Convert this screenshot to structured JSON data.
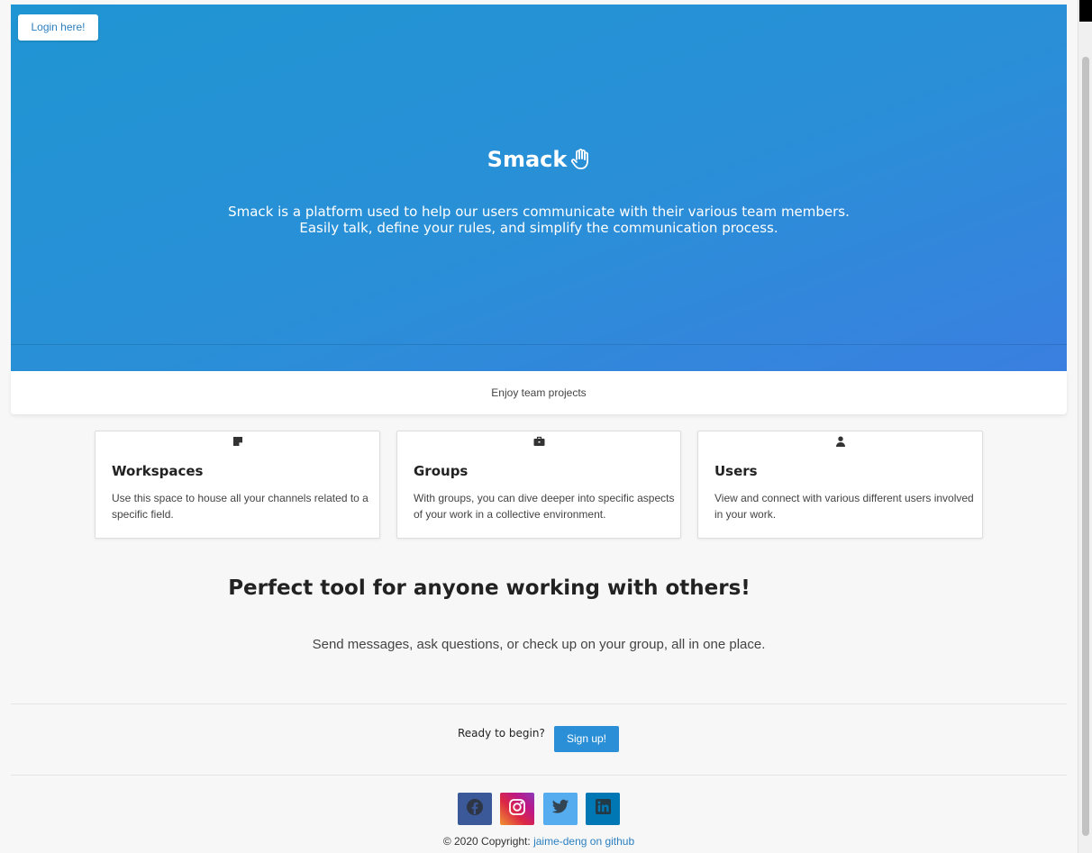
{
  "header": {
    "login_label": "Login here!"
  },
  "hero": {
    "title": "Smack",
    "title_icon": "hand-icon",
    "description_line1": "Smack is a platform used to help our users communicate with their various team members.",
    "description_line2": "Easily talk, define your rules, and simplify the communication process.",
    "gradient_start": "#1f95d3",
    "gradient_end": "#3a7fe0"
  },
  "tagline": "Enjoy team projects",
  "features": [
    {
      "icon": "note-icon",
      "title": "Workspaces",
      "text": "Use this space to house all your channels related to a specific field."
    },
    {
      "icon": "briefcase-icon",
      "title": "Groups",
      "text": "With groups, you can dive deeper into specific aspects of your work in a collective environment."
    },
    {
      "icon": "user-icon",
      "title": "Users",
      "text": "View and connect with various different users involved in your work."
    }
  ],
  "headline": "Perfect tool for anyone working with others!",
  "subline": "Send messages, ask questions, or check up on your group, all in one place.",
  "cta": {
    "ready_text": "Ready to begin?",
    "signup_label": "Sign up!"
  },
  "social": [
    {
      "icon": "facebook-icon",
      "color": "#3b5998"
    },
    {
      "icon": "instagram-icon",
      "color": "#c1358f"
    },
    {
      "icon": "twitter-icon",
      "color": "#55acee"
    },
    {
      "icon": "linkedin-icon",
      "color": "#0077b5"
    }
  ],
  "footer": {
    "copyright_prefix": "© 2020 Copyright:",
    "link_text": "jaime-deng on github"
  },
  "colors": {
    "accent": "#2a8fd7",
    "link": "#2a7fc0"
  }
}
